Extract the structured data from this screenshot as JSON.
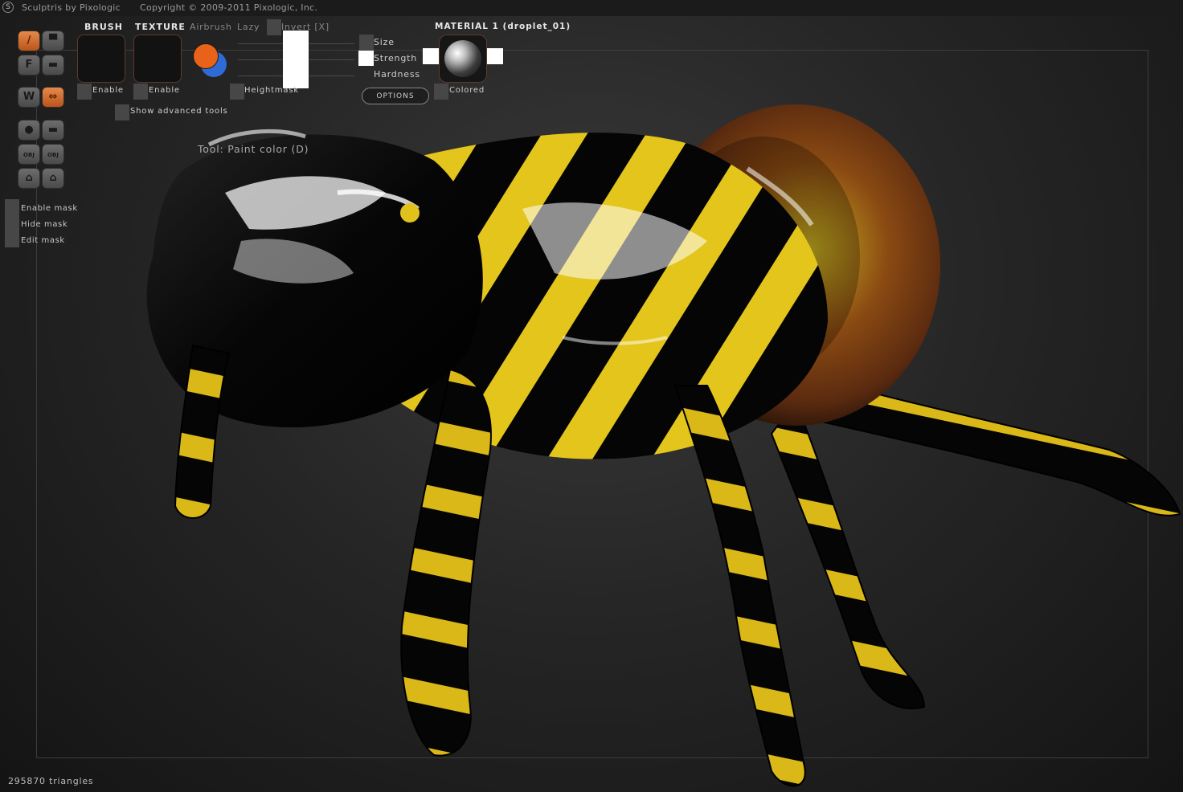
{
  "titlebar": {
    "app_name": "Sculptris by Pixologic",
    "copyright": "Copyright © 2009-2011 Pixologic, Inc."
  },
  "panels": {
    "brush_label": "BRUSH",
    "texture_label": "TEXTURE",
    "airbrush_label": "Airbrush",
    "lazy_label": "Lazy",
    "invert_label": "Invert [X]",
    "brush_enable": "Enable",
    "texture_enable": "Enable",
    "heightmask_label": "Heightmask",
    "show_advanced_label": "Show advanced tools",
    "size_label": "Size",
    "strength_label": "Strength",
    "hardness_label": "Hardness",
    "options_label": "OPTIONS",
    "material_label": "MATERIAL 1 (droplet_01)",
    "colored_label": "Colored"
  },
  "colors": {
    "primary": "#e8621a",
    "secondary": "#2e6bd6",
    "accent": "#d4651f"
  },
  "toolbar": {
    "tools": [
      {
        "name": "paint-color-tool",
        "icon": "brush-icon",
        "glyph": "/"
      },
      {
        "name": "paint-bump-tool",
        "icon": "bump-icon",
        "glyph": "▀"
      },
      {
        "name": "flatten-tool",
        "icon": "flatten-icon",
        "glyph": "F"
      },
      {
        "name": "smooth-tool",
        "icon": "smooth-icon",
        "glyph": "▬"
      },
      {
        "name": "wireframe-tool",
        "icon": "wireframe-icon",
        "glyph": "W"
      },
      {
        "name": "symmetry-tool",
        "icon": "symmetry-icon",
        "glyph": "⇔"
      },
      {
        "name": "sphere-tool",
        "icon": "sphere-icon",
        "glyph": "●"
      },
      {
        "name": "plane-tool",
        "icon": "plane-icon",
        "glyph": "▬"
      },
      {
        "name": "import-obj-tool",
        "icon": "import-obj-icon",
        "glyph": "OBJ"
      },
      {
        "name": "export-obj-tool",
        "icon": "export-obj-icon",
        "glyph": "OBJ"
      },
      {
        "name": "open-file-tool",
        "icon": "open-file-icon",
        "glyph": "⌂"
      },
      {
        "name": "save-file-tool",
        "icon": "save-file-icon",
        "glyph": "⌂"
      }
    ]
  },
  "mask": {
    "enable_label": "Enable mask",
    "hide_label": "Hide mask",
    "edit_label": "Edit mask"
  },
  "viewport": {
    "tool_label": "Tool: Paint color (D)"
  },
  "status": {
    "triangles": "295870 triangles"
  }
}
